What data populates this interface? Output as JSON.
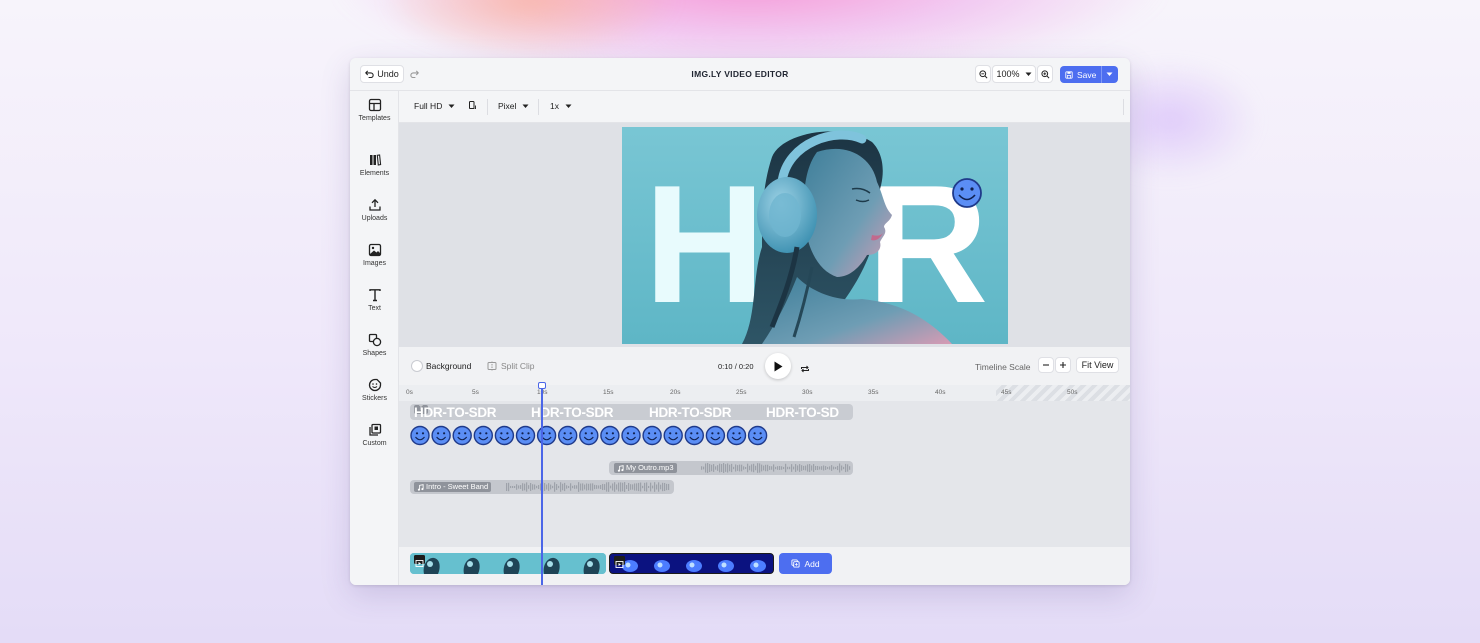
{
  "header": {
    "undo_label": "Undo",
    "title": "IMG.LY VIDEO EDITOR",
    "zoom_value": "100%",
    "save_label": "Save"
  },
  "sidebar": {
    "items": [
      {
        "label": "Templates",
        "icon": "templates-icon"
      },
      {
        "label": "Elements",
        "icon": "elements-icon"
      },
      {
        "label": "Uploads",
        "icon": "upload-icon"
      },
      {
        "label": "Images",
        "icon": "image-icon"
      },
      {
        "label": "Text",
        "icon": "text-icon"
      },
      {
        "label": "Shapes",
        "icon": "shapes-icon"
      },
      {
        "label": "Stickers",
        "icon": "sticker-icon"
      },
      {
        "label": "Custom",
        "icon": "custom-icon"
      }
    ]
  },
  "canvas_toolbar": {
    "format": "Full HD",
    "unit": "Pixel",
    "scale": "1x"
  },
  "canvas": {
    "letters": [
      "H",
      "R"
    ],
    "sticker": "smiley"
  },
  "controls": {
    "background_label": "Background",
    "split_clip_label": "Split Clip",
    "time_current": "0:10",
    "time_separator": "/",
    "time_total": "0:20",
    "timeline_scale_label": "Timeline Scale",
    "fit_view_label": "Fit View"
  },
  "timeline": {
    "ruler_ticks": [
      "0s",
      "5s",
      "10s",
      "15s",
      "20s",
      "25s",
      "30s",
      "35s",
      "40s",
      "45s",
      "50s"
    ],
    "text_track": [
      "HDR-TO-SDR",
      "HDR-TO-SDR",
      "HDR-TO-SDR",
      "HDR-TO-SD"
    ],
    "sticker_count": 17,
    "audio_tracks": [
      {
        "name": "My Outro.mp3"
      },
      {
        "name": "Intro - Sweet Band"
      }
    ],
    "playhead_seconds": 10
  },
  "bottom": {
    "add_label": "Add"
  },
  "colors": {
    "accent": "#4d6ef0",
    "sticker": "#5b8ef5"
  }
}
